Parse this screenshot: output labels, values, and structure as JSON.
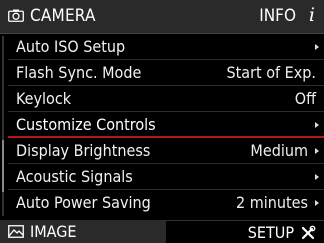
{
  "header": {
    "title": "CAMERA",
    "info_label": "INFO",
    "info_icon": "i"
  },
  "menu": {
    "items": [
      {
        "label": "Auto ISO Setup",
        "value": "",
        "has_submenu": true,
        "selected": false
      },
      {
        "label": "Flash Sync. Mode",
        "value": "Start of Exp.",
        "has_submenu": false,
        "selected": false
      },
      {
        "label": "Keylock",
        "value": "Off",
        "has_submenu": false,
        "selected": false
      },
      {
        "label": "Customize Controls",
        "value": "",
        "has_submenu": true,
        "selected": true
      },
      {
        "label": "Display Brightness",
        "value": "Medium",
        "has_submenu": true,
        "selected": false
      },
      {
        "label": "Acoustic Signals",
        "value": "",
        "has_submenu": true,
        "selected": false
      },
      {
        "label": "Auto Power Saving",
        "value": "2 minutes",
        "has_submenu": true,
        "selected": false
      }
    ]
  },
  "footer": {
    "image_label": "IMAGE",
    "setup_label": "SETUP"
  },
  "colors": {
    "selection_accent": "#b4161b",
    "header_bg": "#2a2a2a",
    "background": "#000000"
  },
  "icons": {
    "header": "camera-icon",
    "info": "info-icon",
    "image_tab": "image-icon",
    "setup_tab": "tools-icon"
  }
}
